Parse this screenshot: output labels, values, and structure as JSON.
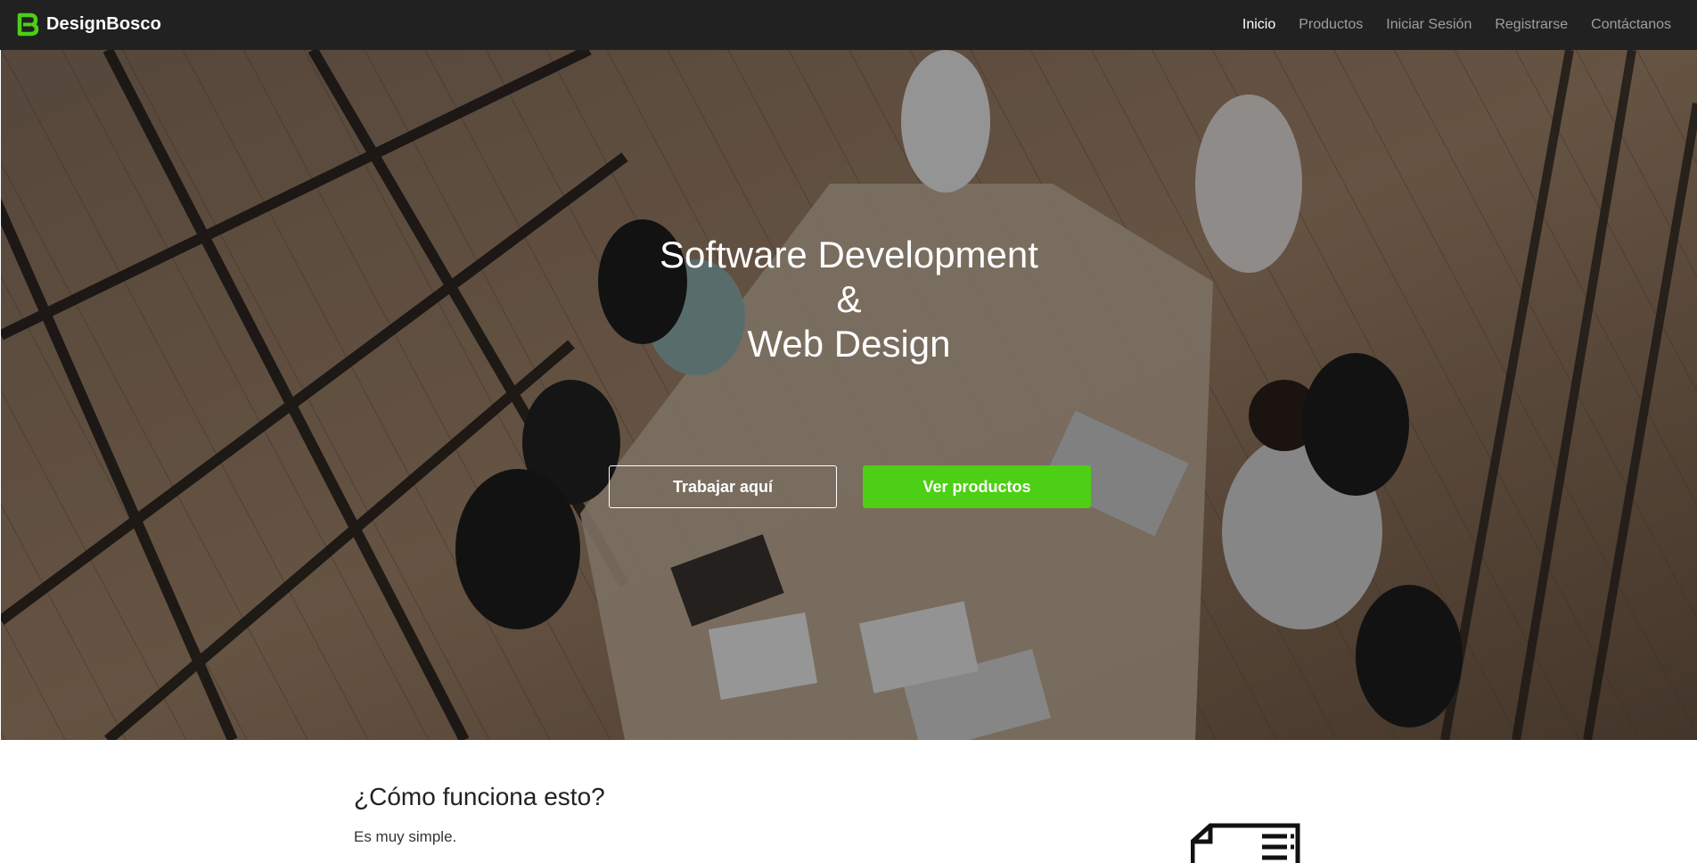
{
  "brand": {
    "name": "DesignBosco",
    "logo_icon": "brand-b-logo-icon",
    "accent": "#4ccf14"
  },
  "nav": {
    "items": [
      {
        "label": "Inicio",
        "active": true
      },
      {
        "label": "Productos",
        "active": false
      },
      {
        "label": "Iniciar Sesión",
        "active": false
      },
      {
        "label": "Registrarse",
        "active": false
      },
      {
        "label": "Contáctanos",
        "active": false
      }
    ]
  },
  "hero": {
    "title_lines": [
      "Software Development",
      "&",
      "Web Design"
    ],
    "background": "office-team-photo",
    "primary_button": "Ver productos",
    "secondary_button": "Trabajar aquí",
    "primary_color": "#4ccf14"
  },
  "section": {
    "title": "¿Cómo funciona esto?",
    "subtitle": "Es muy simple.",
    "icon": "document-list-icon"
  }
}
